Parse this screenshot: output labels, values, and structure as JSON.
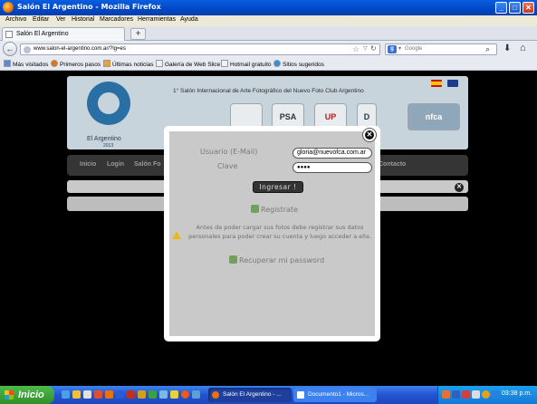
{
  "window": {
    "title": "Salón El Argentino - Mozilla Firefox"
  },
  "menu": [
    "Archivo",
    "Editar",
    "Ver",
    "Historial",
    "Marcadores",
    "Herramientas",
    "Ayuda"
  ],
  "tab": {
    "label": "Salón El Argentino"
  },
  "urlbar": {
    "url": "www.salon-el-argentino.com.ar/?lg=es"
  },
  "search": {
    "placeholder": "Google"
  },
  "bookmarks": [
    "Más visitados",
    "Primeros pasos",
    "Últimas noticias",
    "Galería de Web Slice",
    "Hotmail gratuito",
    "Sitios sugeridos"
  ],
  "site": {
    "title": "1° Salón Internacional de Arte Fotográfico del Nuevo Foto Club Argentino",
    "brand": "El Argentino",
    "year": "2013",
    "sponsors": [
      "PSA",
      "UP",
      "D",
      "nfca"
    ],
    "nav": [
      "Inicio",
      "Login",
      "Salón Fo",
      "Contacto"
    ]
  },
  "login": {
    "user_label": "Usuario (E-Mail)",
    "user_value": "gloria@nuevofca.com.ar",
    "password_label": "Clave",
    "password_value": "●●●●",
    "submit_label": "Ingresar !",
    "register_label": "Registrate",
    "notice": "Antes de poder cargar sus fotos debe registrar sus datos personales para poder crear su cuenta y luego acceder a ella.",
    "recover_label": "Recuperar mi password"
  },
  "taskbar": {
    "start_label": "Inicio",
    "tasks": [
      "Salón El Argentino - ...",
      "Documento1 - Micros..."
    ],
    "clock": "03:38 p.m."
  }
}
